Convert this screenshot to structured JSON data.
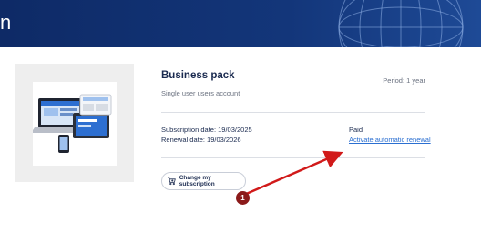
{
  "header": {
    "title": "n"
  },
  "product": {
    "title": "Business pack",
    "subtitle": "Single user users account",
    "period": "Period: 1 year",
    "subscription_date": "Subscription date: 19/03/2025",
    "renewal_date": "Renewal date: 19/03/2026",
    "status": "Paid",
    "renew_link": "Activate automatic renewal",
    "change_button": "Change my subscription",
    "product_image_icon": "laptop-tablet-phone-illustration"
  },
  "annotation": {
    "badge": "1",
    "arrow_color": "#d11a1a"
  },
  "colors": {
    "banner": "#13367a",
    "link": "#2b6fd1",
    "text": "#1a2a4f"
  }
}
